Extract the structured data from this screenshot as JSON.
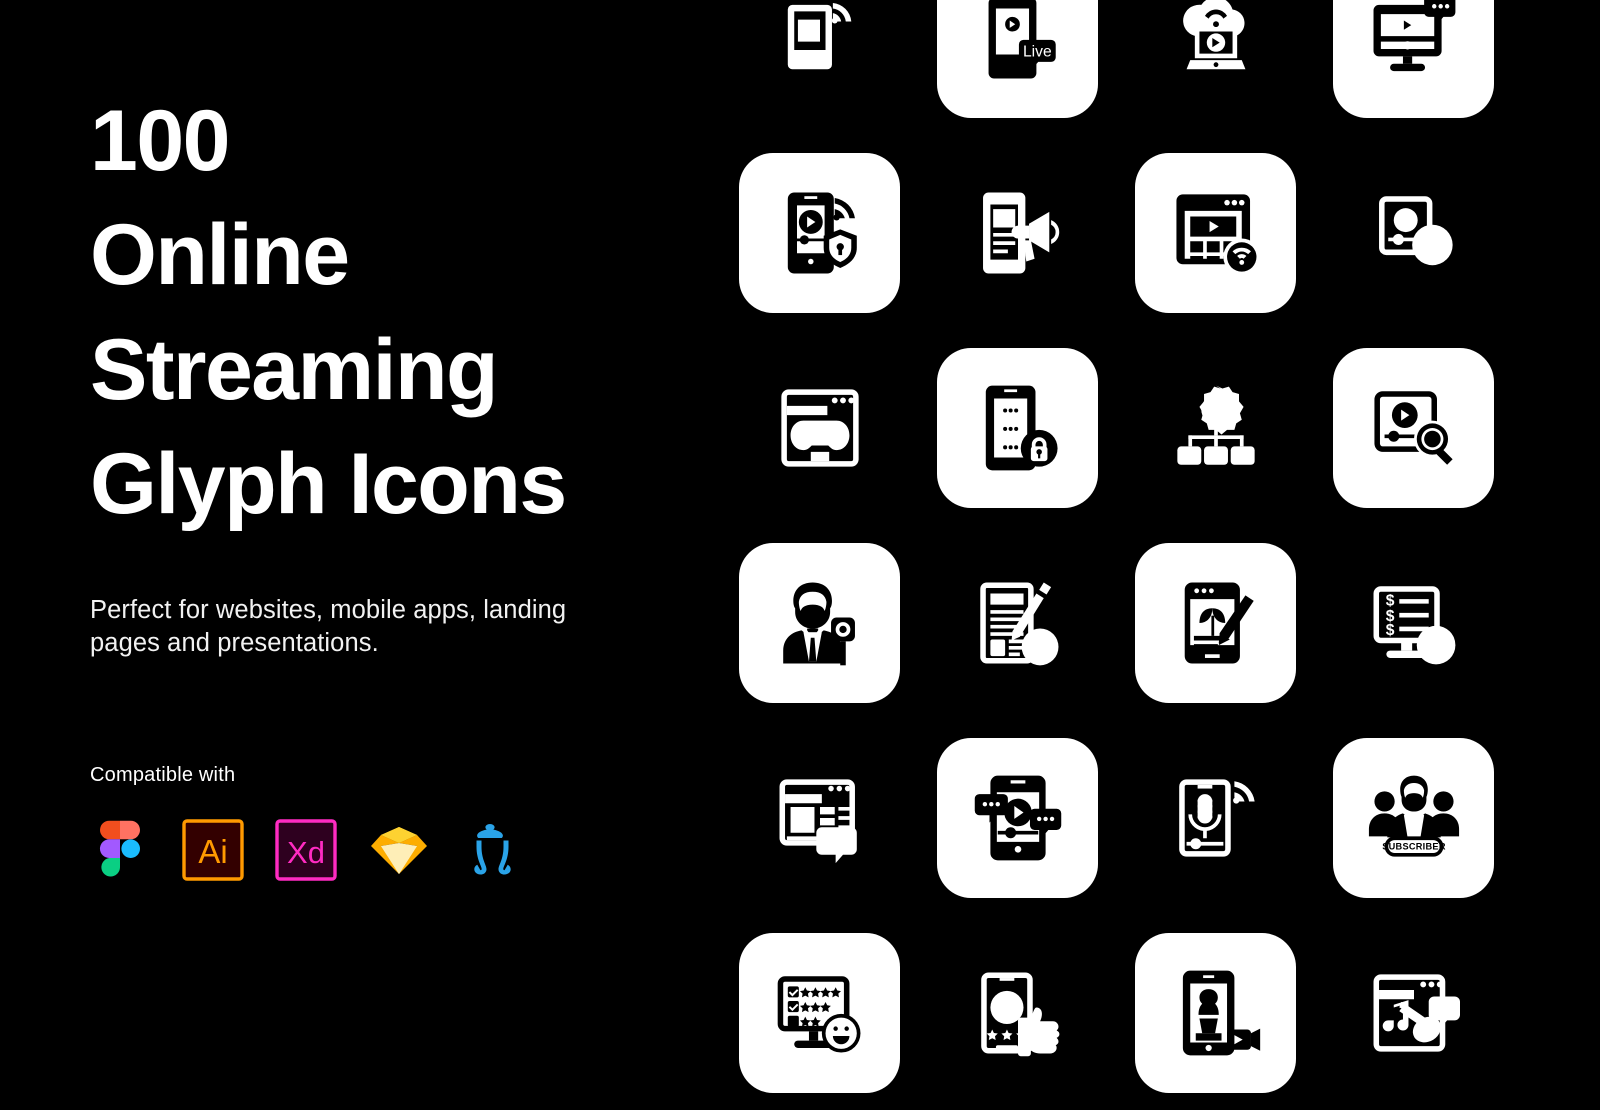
{
  "meta": {
    "background_color": "#000000",
    "tile_color": "#ffffff",
    "text_color": "#ffffff"
  },
  "hero": {
    "title": "100\nOnline\nStreaming\nGlyph Icons",
    "count": "100",
    "subtitle": "Perfect for websites, mobile apps, landing\npages and presentations.",
    "compatible_label": "Compatible with"
  },
  "compatibility": [
    {
      "name": "figma",
      "label": "Figma",
      "accent": "#F24E1E"
    },
    {
      "name": "illustrator",
      "label": "Ai",
      "accent": "#FF9A00"
    },
    {
      "name": "xd",
      "label": "Xd",
      "accent": "#FF2BC2"
    },
    {
      "name": "sketch",
      "label": "Sketch",
      "accent": "#FDB300"
    },
    {
      "name": "inkscape",
      "label": "Inkscape",
      "accent": "#2AA3E8"
    }
  ],
  "grid": {
    "columns": 4,
    "rows": 6,
    "tile_pattern": "checkerboard",
    "icons": [
      {
        "id": "r1c1",
        "name": "tablet-live-stream-wifi-icon",
        "label": "Wireless video streaming on tablet",
        "tile": false
      },
      {
        "id": "r1c2",
        "name": "mobile-live-broadcast-icon",
        "label": "Live mobile broadcast",
        "tile": true,
        "badge": "Live"
      },
      {
        "id": "r1c3",
        "name": "cloud-laptop-streaming-icon",
        "label": "Cloud streaming on laptop",
        "tile": false
      },
      {
        "id": "r1c4",
        "name": "desktop-video-chat-icon",
        "label": "Desktop video with comments",
        "tile": true
      },
      {
        "id": "r2c1",
        "name": "secure-mobile-video-icon",
        "label": "Secure mobile video playback",
        "tile": true
      },
      {
        "id": "r2c2",
        "name": "mobile-video-promotion-icon",
        "label": "Video promotion megaphone",
        "tile": false
      },
      {
        "id": "r2c3",
        "name": "browser-video-wifi-icon",
        "label": "Browser streaming over wifi",
        "tile": true
      },
      {
        "id": "r2c4",
        "name": "share-video-mobile-icon",
        "label": "Share mobile video",
        "tile": false
      },
      {
        "id": "r3c1",
        "name": "browser-game-streaming-icon",
        "label": "Game streaming in browser",
        "tile": false
      },
      {
        "id": "r3c2",
        "name": "mobile-playlist-lock-icon",
        "label": "Locked mobile playlist",
        "tile": true
      },
      {
        "id": "r3c3",
        "name": "video-settings-flowchart-icon",
        "label": "Video settings and distribution",
        "tile": false
      },
      {
        "id": "r3c4",
        "name": "video-search-icon",
        "label": "Search video content",
        "tile": true
      },
      {
        "id": "r4c1",
        "name": "news-reporter-icon",
        "label": "News reporter with microphone",
        "tile": true
      },
      {
        "id": "r4c2",
        "name": "paid-article-icon",
        "label": "Paid article editing",
        "tile": false
      },
      {
        "id": "r4c3",
        "name": "mobile-blog-editor-icon",
        "label": "Mobile blog editor",
        "tile": true
      },
      {
        "id": "r4c4",
        "name": "monetized-content-icon",
        "label": "Monetized desktop content",
        "tile": false
      },
      {
        "id": "r5c1",
        "name": "video-feed-like-icon",
        "label": "Video feed with likes",
        "tile": false
      },
      {
        "id": "r5c2",
        "name": "mobile-video-comments-icon",
        "label": "Mobile video comments",
        "tile": true
      },
      {
        "id": "r5c3",
        "name": "mobile-podcast-mic-icon",
        "label": "Mobile podcast microphone",
        "tile": false
      },
      {
        "id": "r5c4",
        "name": "subscribers-group-icon",
        "label": "Subscriber group",
        "tile": true,
        "badge": "SUBSCRIBER"
      },
      {
        "id": "r6c1",
        "name": "desktop-rating-survey-icon",
        "label": "Rating survey on desktop",
        "tile": true
      },
      {
        "id": "r6c2",
        "name": "mobile-feedback-thumbsup-icon",
        "label": "Mobile feedback thumbs up",
        "tile": false
      },
      {
        "id": "r6c3",
        "name": "mobile-chess-stream-icon",
        "label": "Chess stream on mobile",
        "tile": true
      },
      {
        "id": "r6c4",
        "name": "music-streaming-icon",
        "label": "Music streaming with guitar",
        "tile": false
      }
    ]
  }
}
